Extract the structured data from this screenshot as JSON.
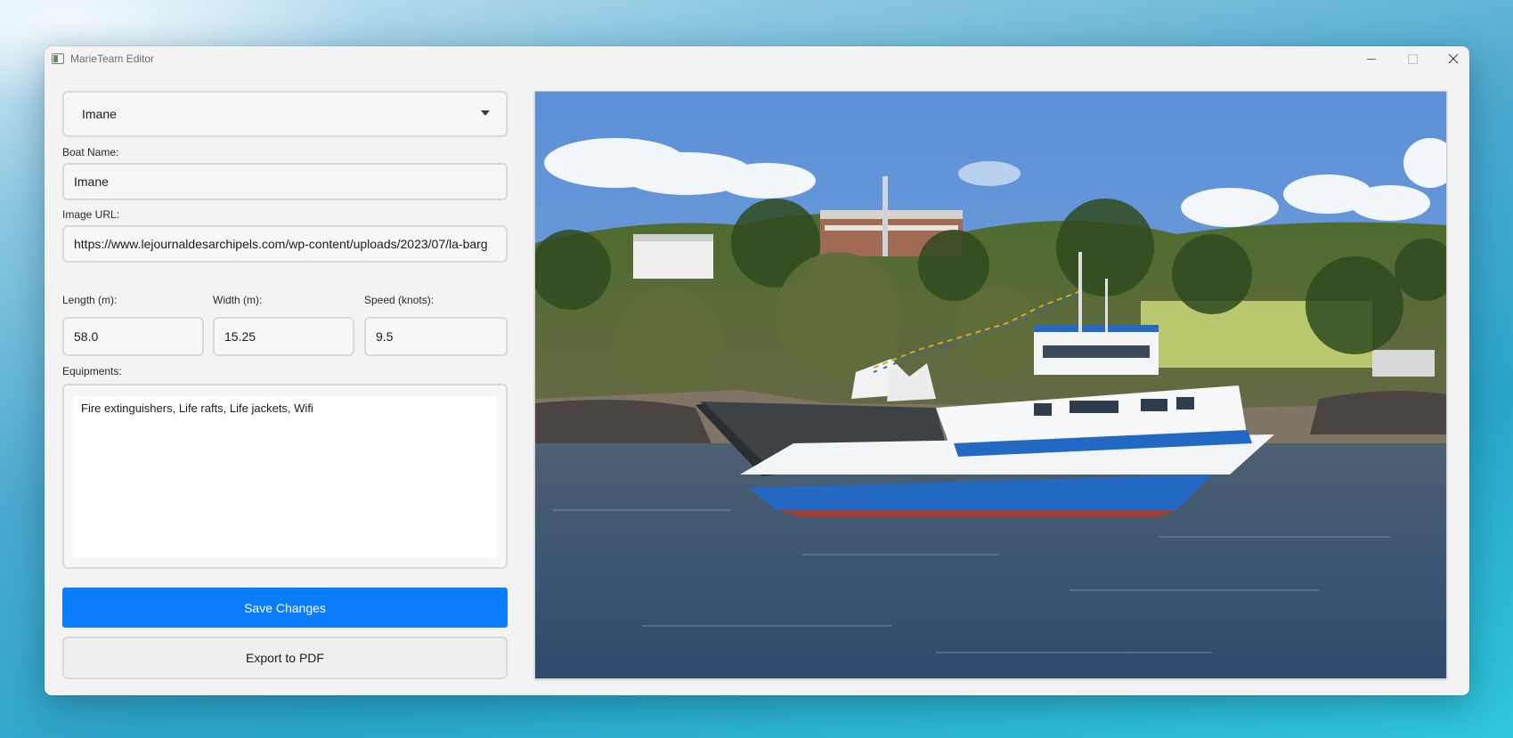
{
  "window": {
    "title": "MarieTeam Editor"
  },
  "boat_selector": {
    "selected": "Imane"
  },
  "form": {
    "boat_name_label": "Boat Name:",
    "boat_name_value": "Imane",
    "image_url_label": "Image URL:",
    "image_url_value": "https://www.lejournaldesarchipels.com/wp-content/uploads/2023/07/la-barg",
    "length_label": "Length (m):",
    "length_value": "58.0",
    "width_label": "Width (m):",
    "width_value": "15.25",
    "speed_label": "Speed (knots):",
    "speed_value": "9.5",
    "equipments_label": "Equipments:",
    "equipments_value": "Fire extinguishers, Life rafts, Life jackets, Wifi"
  },
  "actions": {
    "save_label": "Save Changes",
    "export_label": "Export to PDF"
  },
  "colors": {
    "accent": "#0a7dfc",
    "window_bg": "#f3f3f3"
  },
  "icons": {
    "app": "app-icon",
    "dropdown": "chevron-down-icon",
    "minimize": "minimize-icon",
    "maximize": "maximize-icon",
    "close": "close-icon"
  }
}
